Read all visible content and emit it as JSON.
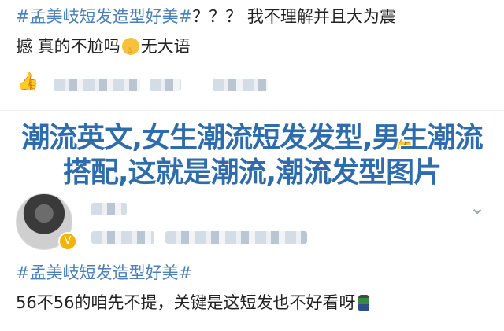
{
  "post1": {
    "hashtag": "#孟美岐短发造型好美#",
    "text_line1": "？？？ 我不理解并且大为震",
    "text_line2_before": "撼 真的不尬吗",
    "text_line2_after": "无大语",
    "emoji": "smirk-star-emoji"
  },
  "overlay": {
    "title": "潮流英文,女生潮流短发发型,男生潮流搭配,这就是潮流,潮流发型图片"
  },
  "post2": {
    "hashtag": "#孟美岐短发造型好美#",
    "text": "56不56的咱先不提，关键是这短发也不好看呀",
    "badge": "V"
  },
  "icons": {
    "like": "thumbs-up-icon",
    "comment": "comment-icon",
    "chevron": "chevron-down-icon"
  }
}
